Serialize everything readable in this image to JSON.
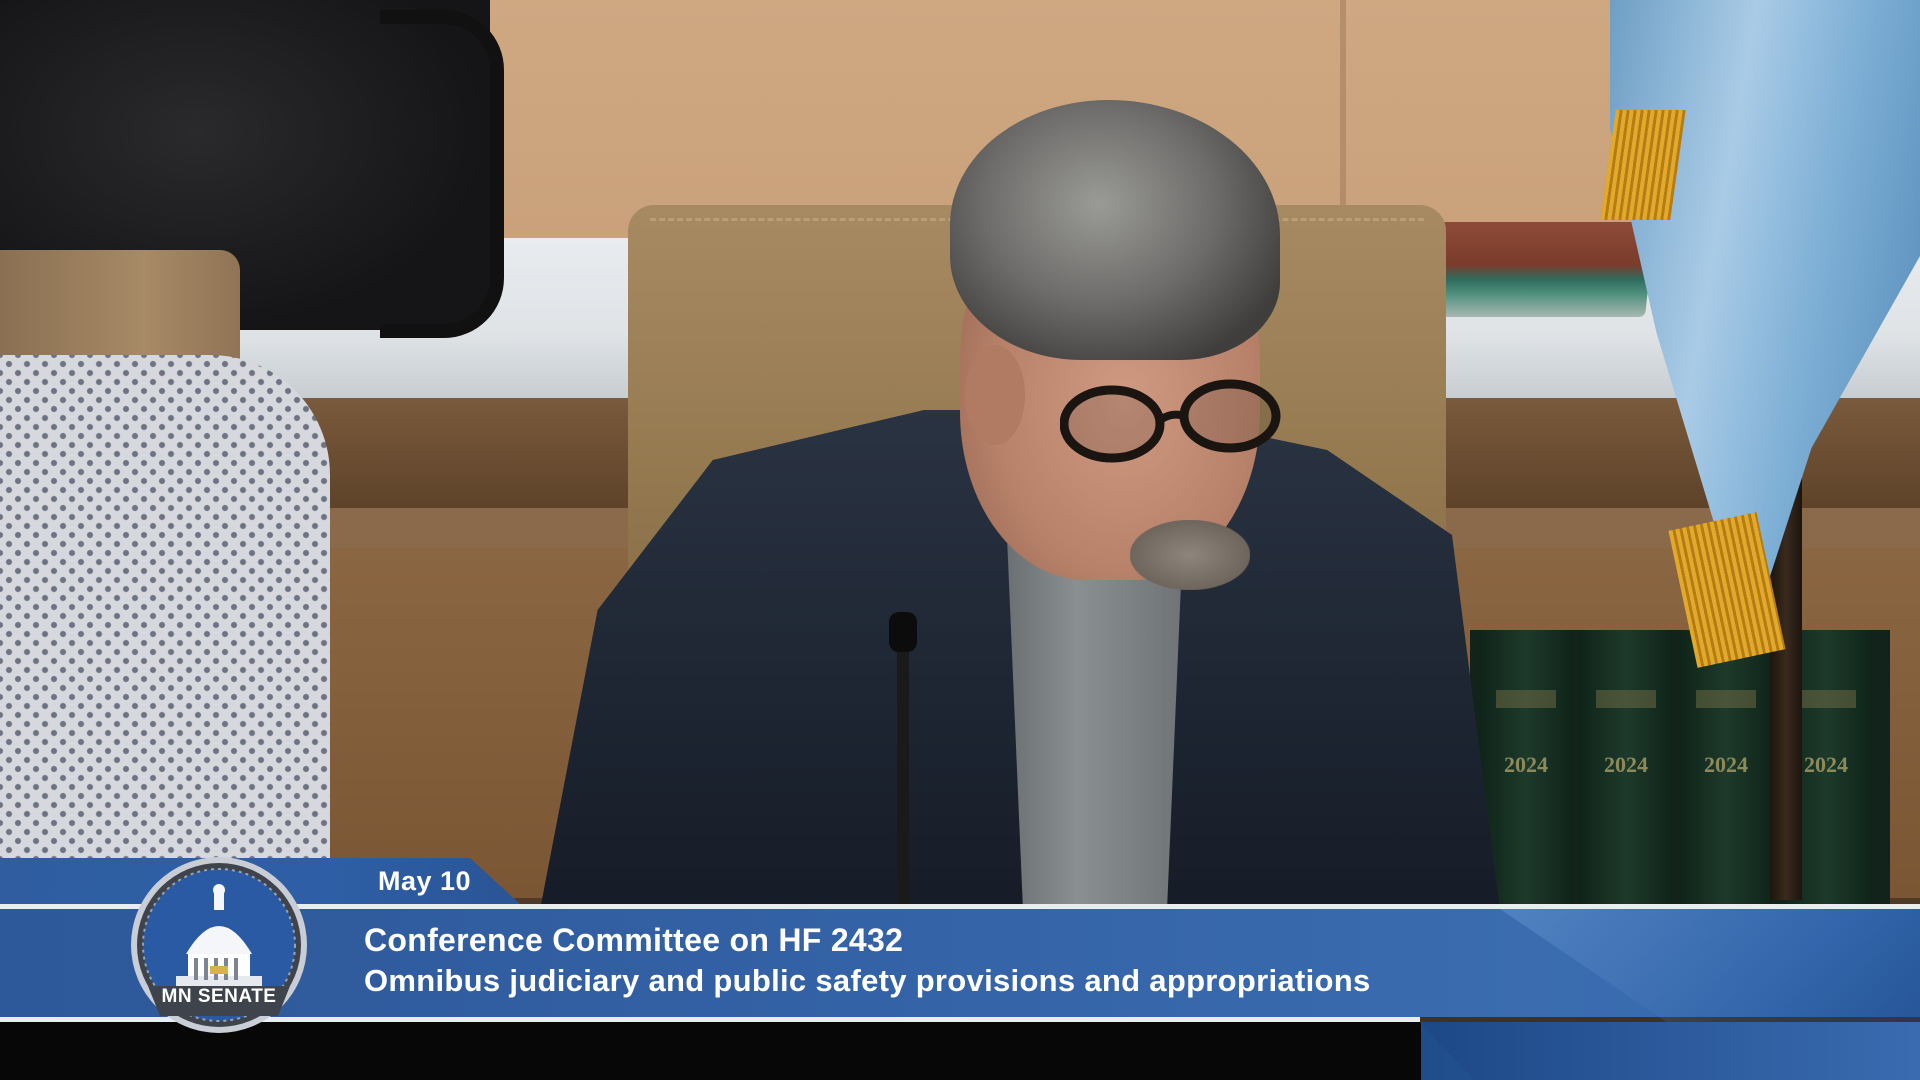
{
  "lower_third": {
    "date": "May 10",
    "title": "Conference Committee on HF 2432",
    "subtitle": "Omnibus judiciary and public safety provisions and appropriations"
  },
  "logo": {
    "text": "MN SENATE",
    "icon": "capitol-dome-icon"
  },
  "background": {
    "book_years": [
      "2024",
      "2024",
      "2024",
      "2024"
    ]
  },
  "colors": {
    "banner_blue": "#2f5da0",
    "banner_text": "#ffffff",
    "divider": "#e8edf5"
  }
}
